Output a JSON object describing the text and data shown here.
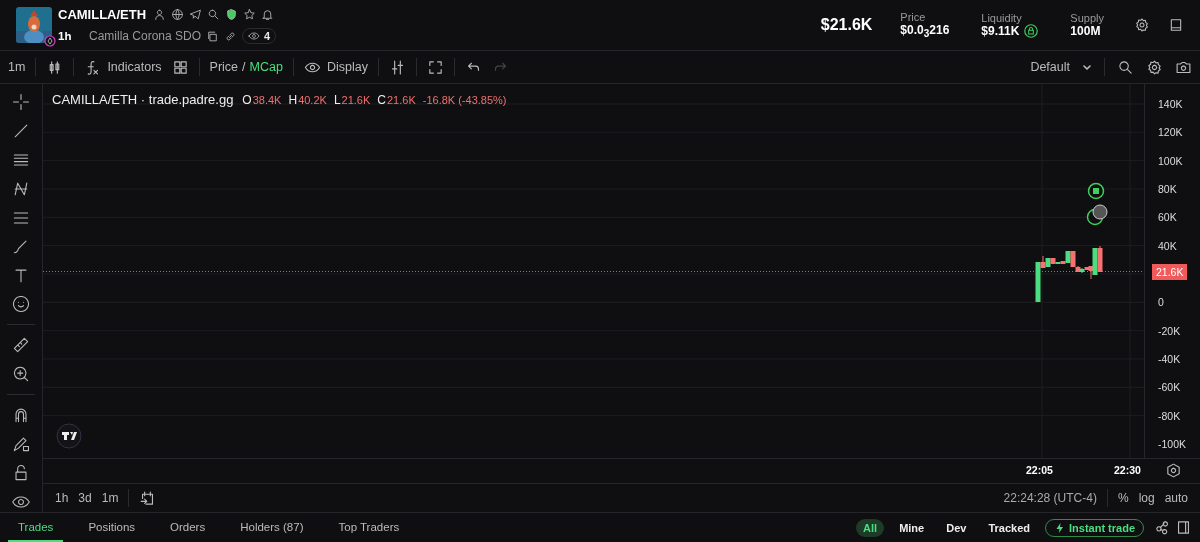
{
  "header": {
    "pair": "CAMILLA/ETH",
    "age": "1h",
    "token_name": "Camilla Corona SDO",
    "watchers": "4",
    "market_cap": "$21.6K",
    "stats": [
      {
        "label": "Price",
        "value": "$0.0$_{3}$216",
        "locked": false
      },
      {
        "label": "Liquidity",
        "value": "$9.11K",
        "locked": true
      },
      {
        "label": "Supply",
        "value": "100M",
        "locked": false
      }
    ]
  },
  "toolbar": {
    "interval": "1m",
    "indicators": "Indicators",
    "price_toggle": [
      {
        "label": "Price",
        "selected": false
      },
      {
        "label": "MCap",
        "selected": true
      }
    ],
    "toggle_separator": "/",
    "display": "Display",
    "undo_disabled": false,
    "redo_disabled": true,
    "layout": "Default"
  },
  "chart": {
    "legend": {
      "title": "CAMILLA/ETH · trade.padre.gg",
      "values": [
        {
          "key": "O",
          "value": "38.4K"
        },
        {
          "key": "H",
          "value": "40.2K"
        },
        {
          "key": "L",
          "value": "21.6K"
        },
        {
          "key": "C",
          "value": "21.6K"
        }
      ],
      "change": "-16.8K (-43.85%)"
    },
    "price_axis": [
      "140K",
      "120K",
      "100K",
      "80K",
      "60K",
      "40K",
      "0",
      "-20K",
      "-40K",
      "-60K",
      "-80K",
      "-100K"
    ],
    "current_price": "21.6K",
    "time_axis": [
      "22:05",
      "22:30"
    ],
    "ranges": [
      {
        "label": "1h"
      },
      {
        "label": "3d"
      },
      {
        "label": "1m"
      }
    ],
    "clock": "22:24:28 (UTC-4)",
    "scale_options": [
      "%",
      "log",
      "auto"
    ]
  },
  "bottom_tabs": [
    {
      "label": "Trades",
      "selected": true
    },
    {
      "label": "Positions",
      "selected": false
    },
    {
      "label": "Orders",
      "selected": false
    },
    {
      "label": "Holders (87)",
      "selected": false
    },
    {
      "label": "Top Traders",
      "selected": false
    }
  ],
  "filters": [
    {
      "label": "All",
      "selected": true
    },
    {
      "label": "Mine",
      "selected": false
    },
    {
      "label": "Dev",
      "selected": false
    },
    {
      "label": "Tracked",
      "selected": false
    }
  ],
  "instant_trade": "Instant trade"
}
